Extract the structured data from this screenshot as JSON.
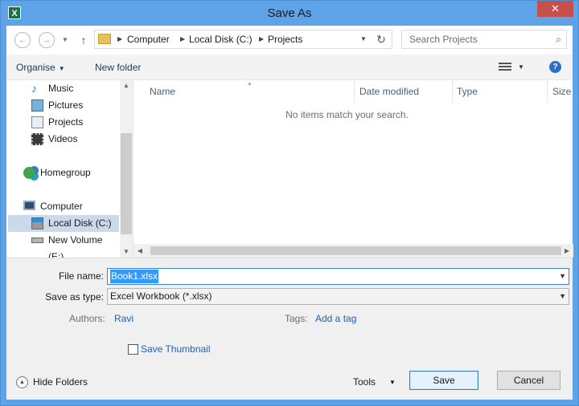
{
  "window": {
    "title": "Save As",
    "app_icon": "X",
    "close_label": "✕"
  },
  "address": {
    "crumbs": [
      "Computer",
      "Local Disk (C:)",
      "Projects"
    ],
    "search_placeholder": "Search Projects"
  },
  "toolbar": {
    "organise": "Organise",
    "new_folder": "New folder",
    "help": "?"
  },
  "nav": {
    "items": [
      {
        "label": "Music",
        "icon": "music-icon"
      },
      {
        "label": "Pictures",
        "icon": "pictures-icon"
      },
      {
        "label": "Projects",
        "icon": "folder-icon"
      },
      {
        "label": "Videos",
        "icon": "videos-icon"
      },
      {
        "label": "Homegroup",
        "icon": "homegroup-icon"
      },
      {
        "label": "Computer",
        "icon": "computer-icon"
      },
      {
        "label": "Local Disk (C:)",
        "icon": "local-disk-icon",
        "selected": true
      },
      {
        "label": "New Volume (E:)",
        "icon": "drive-icon"
      }
    ]
  },
  "filelist": {
    "columns": [
      "Name",
      "Date modified",
      "Type",
      "Size"
    ],
    "empty_message": "No items match your search."
  },
  "form": {
    "file_name_label": "File name:",
    "file_name_value": "Book1.xlsx",
    "save_as_type_label": "Save as type:",
    "save_as_type_value": "Excel Workbook (*.xlsx)",
    "authors_label": "Authors:",
    "authors_value": "Ravi",
    "tags_label": "Tags:",
    "tags_value": "Add a tag",
    "thumbnail_label": "Save Thumbnail",
    "hide_folders": "Hide Folders",
    "tools": "Tools",
    "save": "Save",
    "cancel": "Cancel"
  },
  "colors": {
    "title_bar": "#5ea3e8",
    "link": "#1f5fb4",
    "selection": "#3399ff",
    "close": "#c7504c"
  }
}
